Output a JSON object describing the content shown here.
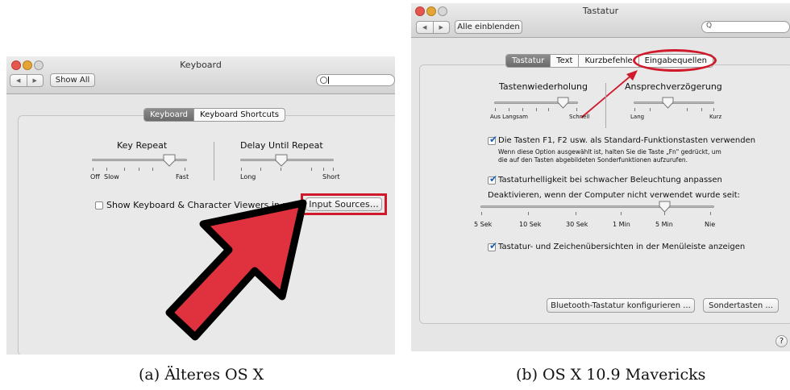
{
  "left_window": {
    "title": "Keyboard",
    "show_all": "Show All",
    "tabs": [
      {
        "label": "Keyboard",
        "selected": true
      },
      {
        "label": "Keyboard Shortcuts",
        "selected": false
      }
    ],
    "key_repeat": {
      "title": "Key Repeat",
      "labels": [
        "Off",
        "Slow",
        "Fast"
      ]
    },
    "delay_until_repeat": {
      "title": "Delay Until Repeat",
      "labels": [
        "Long",
        "Short"
      ]
    },
    "show_viewers_checkbox": {
      "label": "Show Keyboard & Character Viewers in menu bar",
      "checked": false
    },
    "input_sources_button": "Input Sources…",
    "highlight_color": "#d0192b",
    "arrow_color": "#e0323e"
  },
  "right_window": {
    "title": "Tastatur",
    "show_all": "Alle einblenden",
    "search_placeholder": "Q",
    "tabs": [
      {
        "label": "Tastatur",
        "selected": true
      },
      {
        "label": "Text",
        "selected": false
      },
      {
        "label": "Kurzbefehle",
        "selected": false
      },
      {
        "label": "Eingabequellen",
        "selected": false
      }
    ],
    "key_repeat": {
      "title": "Tastenwiederholung",
      "left": "Aus Langsam",
      "right": "Schnell"
    },
    "delay": {
      "title": "Ansprechverzögerung",
      "left": "Lang",
      "right": "Kurz"
    },
    "fn_keys": {
      "label": "Die Tasten F1, F2 usw. als Standard-Funktionstasten verwenden",
      "desc1": "Wenn diese Option ausgewählt ist, halten Sie die Taste „Fn\" gedrückt, um",
      "desc2": "die auf den Tasten abgebildeten Sonderfunktionen aufzurufen.",
      "checked": true
    },
    "brightness": {
      "label": "Tastaturhelligkeit bei schwacher Beleuchtung anpassen",
      "checked": true
    },
    "deactivate_label": "Deaktivieren, wenn der Computer nicht verwendet wurde seit:",
    "deactivate_ticks": [
      "5 Sek",
      "10 Sek",
      "30 Sek",
      "1 Min",
      "5 Min",
      "Nie"
    ],
    "viewers": {
      "label": "Tastatur- und Zeichenübersichten in der Menüleiste anzeigen",
      "checked": true
    },
    "bluetooth_button": "Bluetooth-Tastatur konfigurieren ...",
    "special_keys_button": "Sondertasten ...",
    "help": "?",
    "highlight_color": "#d0192b"
  },
  "captions": {
    "left": "(a) Älteres OS X",
    "right": "(b) OS X 10.9 Mavericks"
  }
}
